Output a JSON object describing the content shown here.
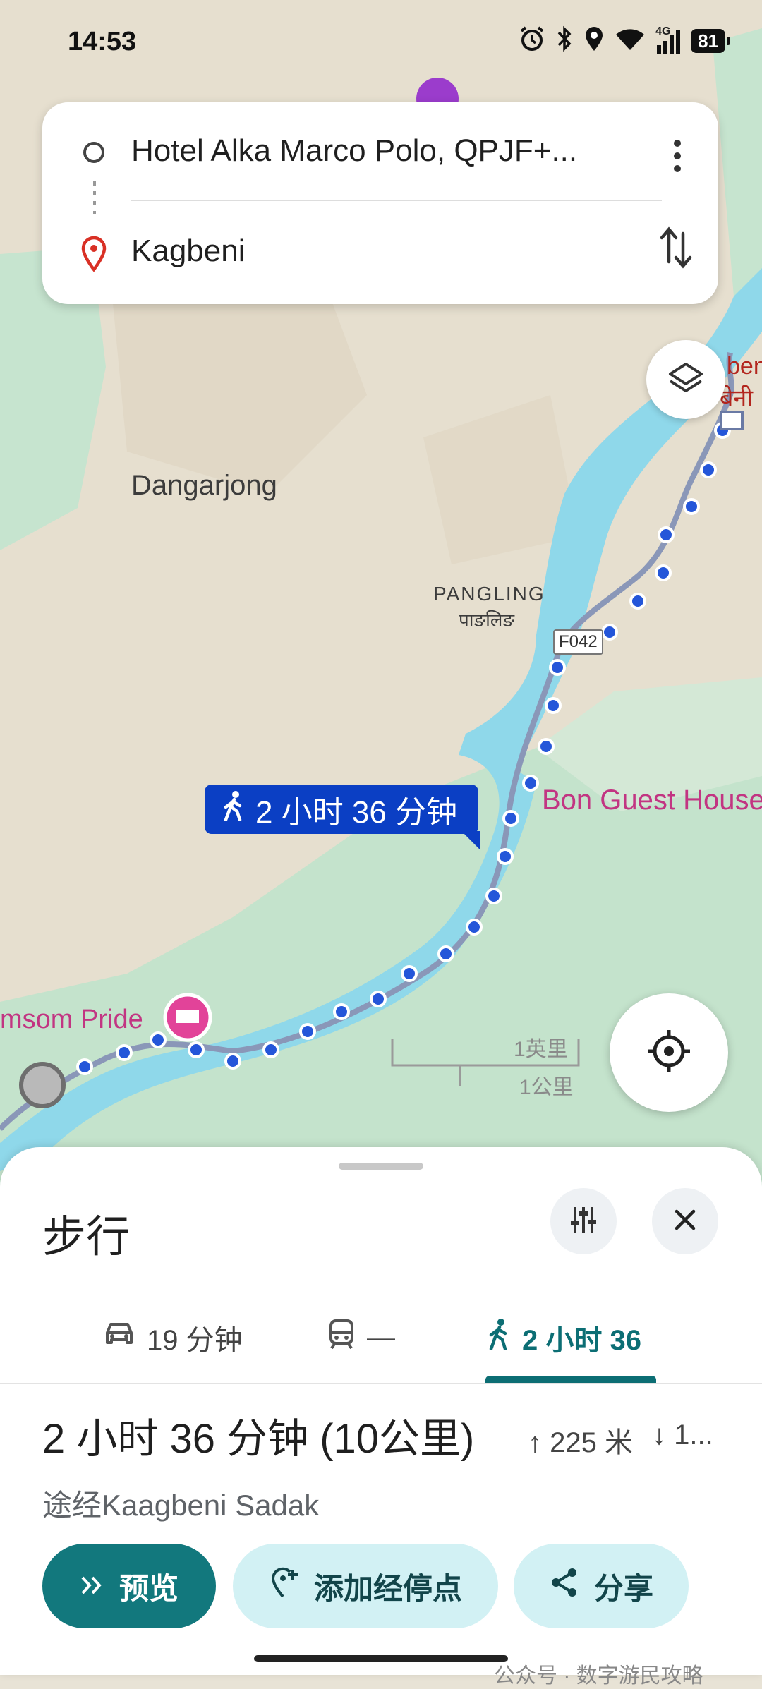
{
  "status_bar": {
    "time": "14:53",
    "battery": "81",
    "network": "4G"
  },
  "search": {
    "origin": "Hotel Alka Marco Polo, QPJF+...",
    "destination": "Kagbeni"
  },
  "map": {
    "labels": {
      "dangarjong": "Dangarjong",
      "pangling": "PANGLING",
      "pangling_local": "पाङलिङ",
      "road_badge": "F042",
      "bon_guest_house": "Bon Guest House",
      "jomsom_pride": "msom Pride",
      "kagbeni_partial_top": "beni",
      "kagbeni_partial_local": "बेनी",
      "scale_miles": "1英里",
      "scale_km": "1公里"
    },
    "route_duration_label": "2 小时 36 分钟",
    "colors": {
      "water": "#8fd8ea",
      "route": "#2456d9",
      "land": "#e6dfcf",
      "green": "#bfe3cc"
    }
  },
  "sheet": {
    "title": "步行",
    "modes": [
      {
        "icon": "car-icon",
        "label": "19 分钟"
      },
      {
        "icon": "train-icon",
        "label": "—"
      },
      {
        "icon": "walk-icon",
        "label": "2 小时 36"
      }
    ],
    "summary": "2 小时 36 分钟 (10公里)",
    "ascent": "225 米",
    "descent": "1...",
    "via": "途经Kaagbeni Sadak",
    "buttons": {
      "preview": "预览",
      "add_stop": "添加经停点",
      "share": "分享"
    }
  },
  "watermark": "公众号 · 数字游民攻略"
}
